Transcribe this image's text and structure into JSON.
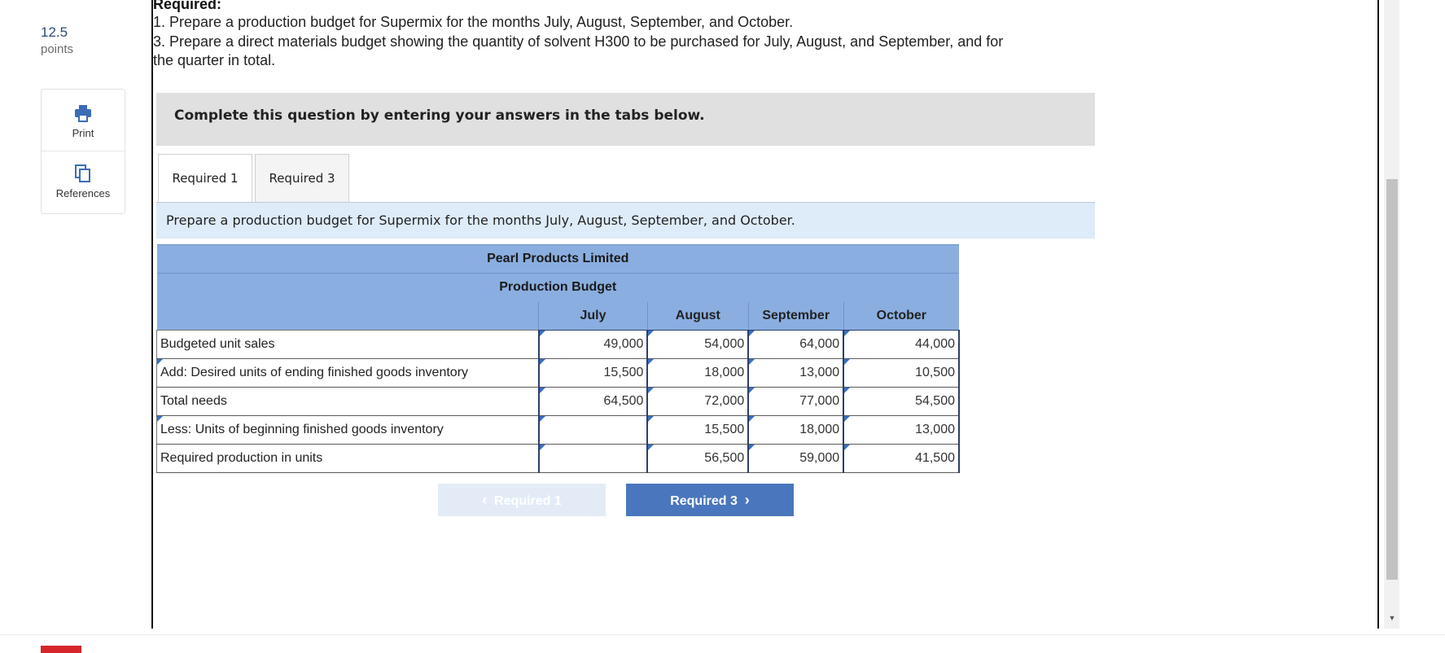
{
  "points": {
    "value": "12.5",
    "label": "points"
  },
  "sidebar": {
    "print_label": "Print",
    "references_label": "References"
  },
  "instructions": {
    "heading": "Required:",
    "lines": [
      "1. Prepare a production budget for Supermix for the months July, August, September, and October.",
      "3. Prepare a direct materials budget showing the quantity of solvent H300 to be purchased for July, August, and September, and for",
      "the quarter in total."
    ]
  },
  "banner": {
    "text": "Complete this question by entering your answers in the tabs below."
  },
  "tabs": [
    {
      "label": "Required 1",
      "active": true
    },
    {
      "label": "Required 3",
      "active": false
    }
  ],
  "prompt": {
    "text": "Prepare a production budget for Supermix for the months July, August, September, and October."
  },
  "table": {
    "company": "Pearl Products Limited",
    "title": "Production Budget",
    "columns": [
      "July",
      "August",
      "September",
      "October"
    ],
    "rows": [
      {
        "label": "Budgeted unit sales",
        "values": [
          "49,000",
          "54,000",
          "64,000",
          "44,000"
        ]
      },
      {
        "label": "Add: Desired units of ending finished goods inventory",
        "values": [
          "15,500",
          "18,000",
          "13,000",
          "10,500"
        ]
      },
      {
        "label": "Total needs",
        "values": [
          "64,500",
          "72,000",
          "77,000",
          "54,500"
        ]
      },
      {
        "label": "Less: Units of beginning finished goods inventory",
        "values": [
          "",
          "15,500",
          "18,000",
          "13,000"
        ]
      },
      {
        "label": "Required production in units",
        "values": [
          "",
          "56,500",
          "59,000",
          "41,500"
        ]
      }
    ]
  },
  "nav": {
    "prev_label": "Required 1",
    "next_label": "Required 3"
  },
  "colors": {
    "header_blue": "#8aaee0",
    "button_blue": "#4a76bd",
    "prompt_bg": "#deebf8",
    "logo_red": "#d6262b"
  }
}
